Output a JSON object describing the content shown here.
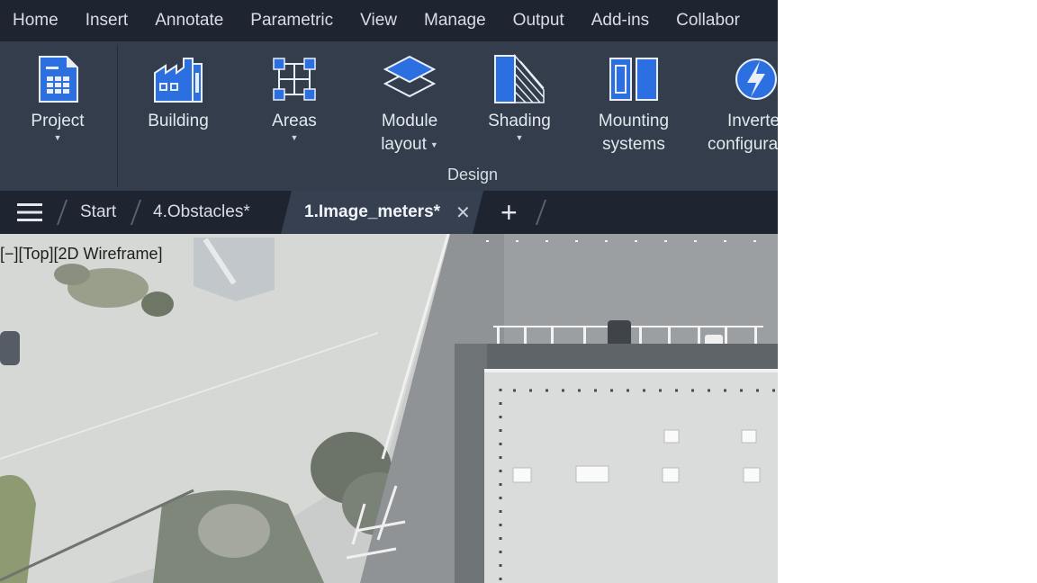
{
  "menu": [
    "Home",
    "Insert",
    "Annotate",
    "Parametric",
    "View",
    "Manage",
    "Output",
    "Add-ins",
    "Collabor"
  ],
  "ribbon": {
    "buttons": [
      {
        "label": "Project",
        "dropdown": true,
        "icon": "project-icon"
      },
      {
        "label": "Building",
        "dropdown": false,
        "icon": "building-icon"
      },
      {
        "label": "Areas",
        "dropdown": true,
        "icon": "areas-icon"
      },
      {
        "label_line1": "Module",
        "label_line2": "layout",
        "dropdown": true,
        "icon": "module-layout-icon"
      },
      {
        "label": "Shading",
        "dropdown": true,
        "icon": "shading-icon"
      },
      {
        "label_line1": "Mounting",
        "label_line2": "systems",
        "dropdown": false,
        "icon": "mounting-systems-icon"
      },
      {
        "label_line1": "Inverte",
        "label_line2": "configura",
        "dropdown": false,
        "icon": "inverter-icon"
      }
    ],
    "group_label": "Design",
    "accent": "#2b6fe0"
  },
  "tabs": {
    "items": [
      "Start",
      "4.Obstacles*",
      "1.Image_meters*"
    ],
    "active": "1.Image_meters*",
    "close_glyph": "✕",
    "new_tab_glyph": "+"
  },
  "viewport": {
    "label": "[−][Top][2D Wireframe]"
  }
}
